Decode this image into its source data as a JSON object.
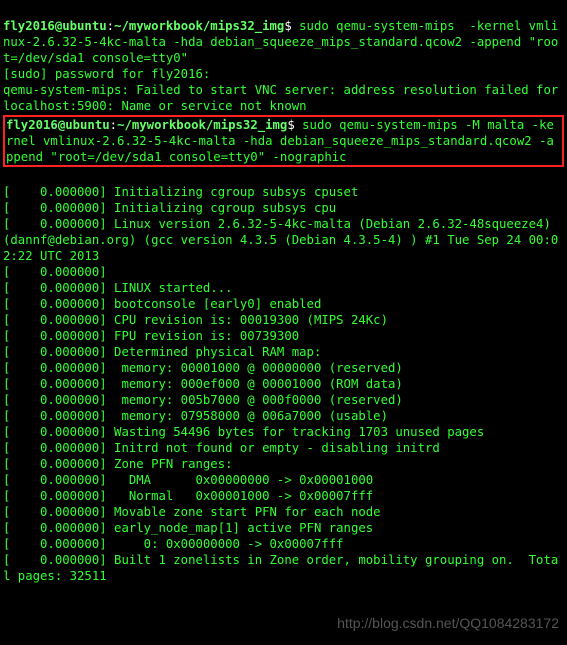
{
  "prompt1": {
    "user_host": "fly2016@ubuntu",
    "sep": ":",
    "path": "~/myworkbook/mips32_img",
    "dollar": "$",
    "command1": "sudo qemu-system-mips  -kernel vmlinux-2.6.32-5-4kc-malta -hda debian_squeeze_mips_standard.qcow2 -append \"root=/dev/sda1 console=tty0\""
  },
  "out1": {
    "l1": "[sudo] password for fly2016:",
    "l2": "qemu-system-mips: Failed to start VNC server: address resolution failed for localhost:5900: Name or service not known"
  },
  "prompt2": {
    "user_host": "fly2016@ubuntu",
    "sep": ":",
    "path": "~/myworkbook/mips32_img",
    "dollar": "$",
    "command2": "sudo qemu-system-mips -M malta -kernel vmlinux-2.6.32-5-4kc-malta -hda debian_squeeze_mips_standard.qcow2 -append \"root=/dev/sda1 console=tty0\" -nographic"
  },
  "boot": [
    "[    0.000000] Initializing cgroup subsys cpuset",
    "[    0.000000] Initializing cgroup subsys cpu",
    "[    0.000000] Linux version 2.6.32-5-4kc-malta (Debian 2.6.32-48squeeze4) (dannf@debian.org) (gcc version 4.3.5 (Debian 4.3.5-4) ) #1 Tue Sep 24 00:02:22 UTC 2013",
    "[    0.000000] ",
    "[    0.000000] LINUX started...",
    "[    0.000000] bootconsole [early0] enabled",
    "[    0.000000] CPU revision is: 00019300 (MIPS 24Kc)",
    "[    0.000000] FPU revision is: 00739300",
    "[    0.000000] Determined physical RAM map:",
    "[    0.000000]  memory: 00001000 @ 00000000 (reserved)",
    "[    0.000000]  memory: 000ef000 @ 00001000 (ROM data)",
    "[    0.000000]  memory: 005b7000 @ 000f0000 (reserved)",
    "[    0.000000]  memory: 07958000 @ 006a7000 (usable)",
    "[    0.000000] Wasting 54496 bytes for tracking 1703 unused pages",
    "[    0.000000] Initrd not found or empty - disabling initrd",
    "[    0.000000] Zone PFN ranges:",
    "[    0.000000]   DMA      0x00000000 -> 0x00001000",
    "[    0.000000]   Normal   0x00001000 -> 0x00007fff",
    "[    0.000000] Movable zone start PFN for each node",
    "[    0.000000] early_node_map[1] active PFN ranges",
    "[    0.000000]     0: 0x00000000 -> 0x00007fff",
    "[    0.000000] Built 1 zonelists in Zone order, mobility grouping on.  Total pages: 32511"
  ],
  "watermark": "http://blog.csdn.net/QQ1084283172"
}
